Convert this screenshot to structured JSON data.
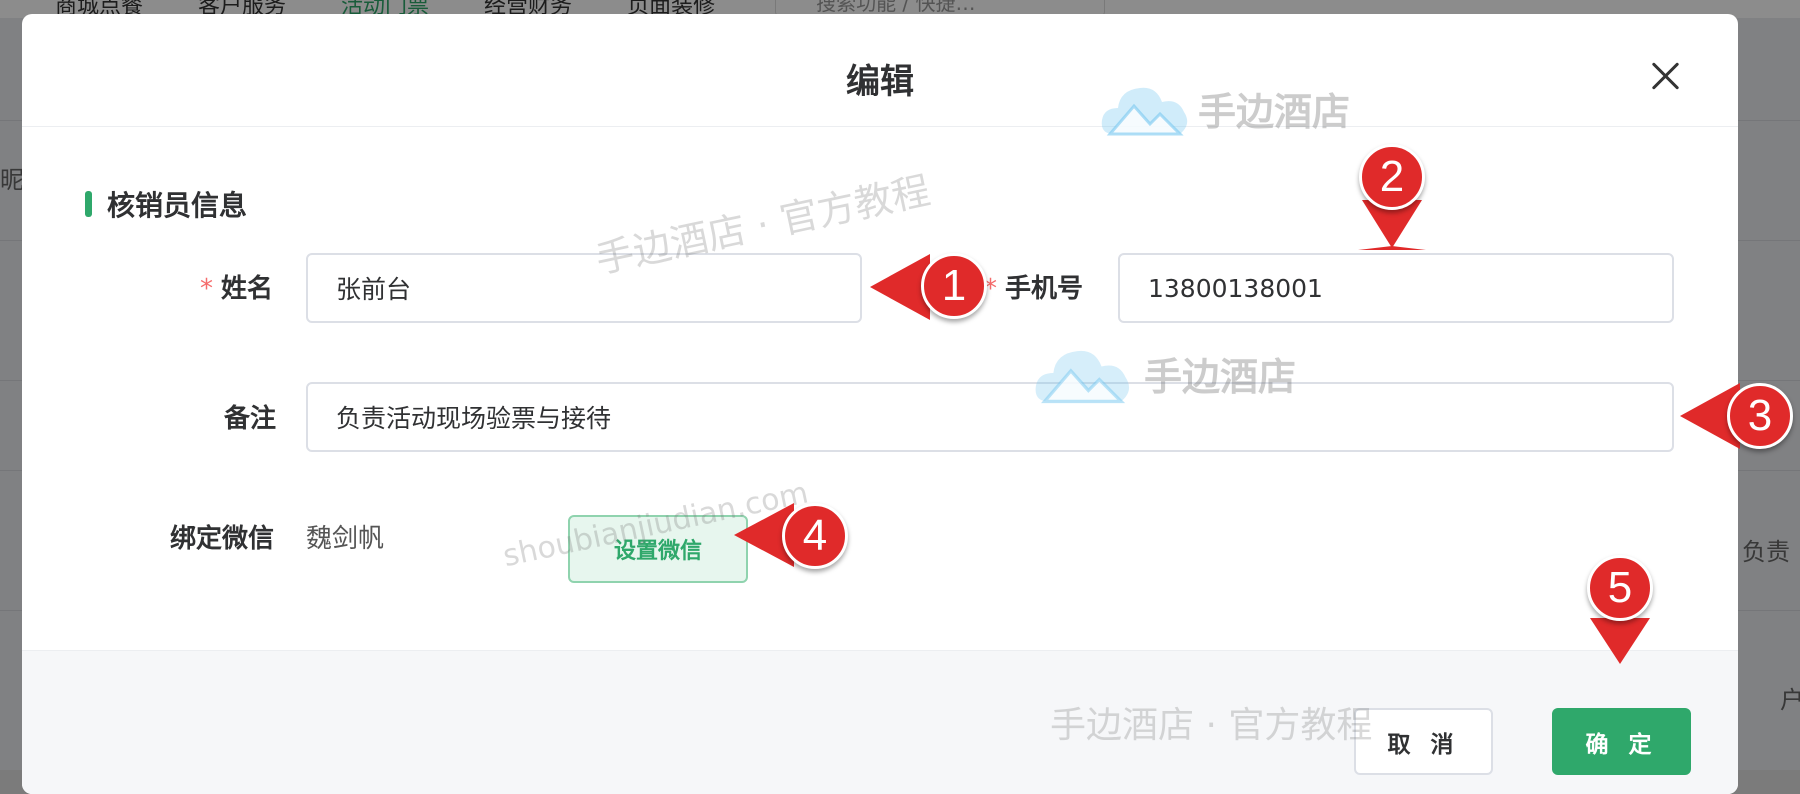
{
  "background": {
    "nav_items": [
      "商城点餐",
      "客户服务",
      "活动门票",
      "经营财务",
      "页面装修"
    ],
    "active_nav_index": 2,
    "search_placeholder": "搜索功能 / 快捷…",
    "side_text_left": "昵",
    "side_text_right_1": "负责",
    "side_text_right_2": "户"
  },
  "dialog": {
    "title": "编辑",
    "section_title": "核销员信息",
    "fields": {
      "name": {
        "label": "姓名",
        "required": true,
        "value": "张前台"
      },
      "phone": {
        "label": "手机号",
        "required": true,
        "value": "13800138001"
      },
      "remark": {
        "label": "备注",
        "required": false,
        "value": "负责活动现场验票与接待"
      },
      "wechat": {
        "label": "绑定微信",
        "value": "魏剑帆",
        "button_label": "设置微信"
      }
    },
    "required_mark": "*",
    "footer": {
      "cancel_label": "取 消",
      "ok_label": "确 定"
    }
  },
  "watermarks": {
    "logo_text": "手边酒店",
    "tutorial_text": "手边酒店 · 官方教程",
    "domain_text": "shoubianjiudian.com"
  },
  "callouts": [
    "1",
    "2",
    "3",
    "4",
    "5"
  ],
  "colors": {
    "accent": "#2fa86b",
    "required": "#f56c6c",
    "callout": "#e02a2a"
  }
}
